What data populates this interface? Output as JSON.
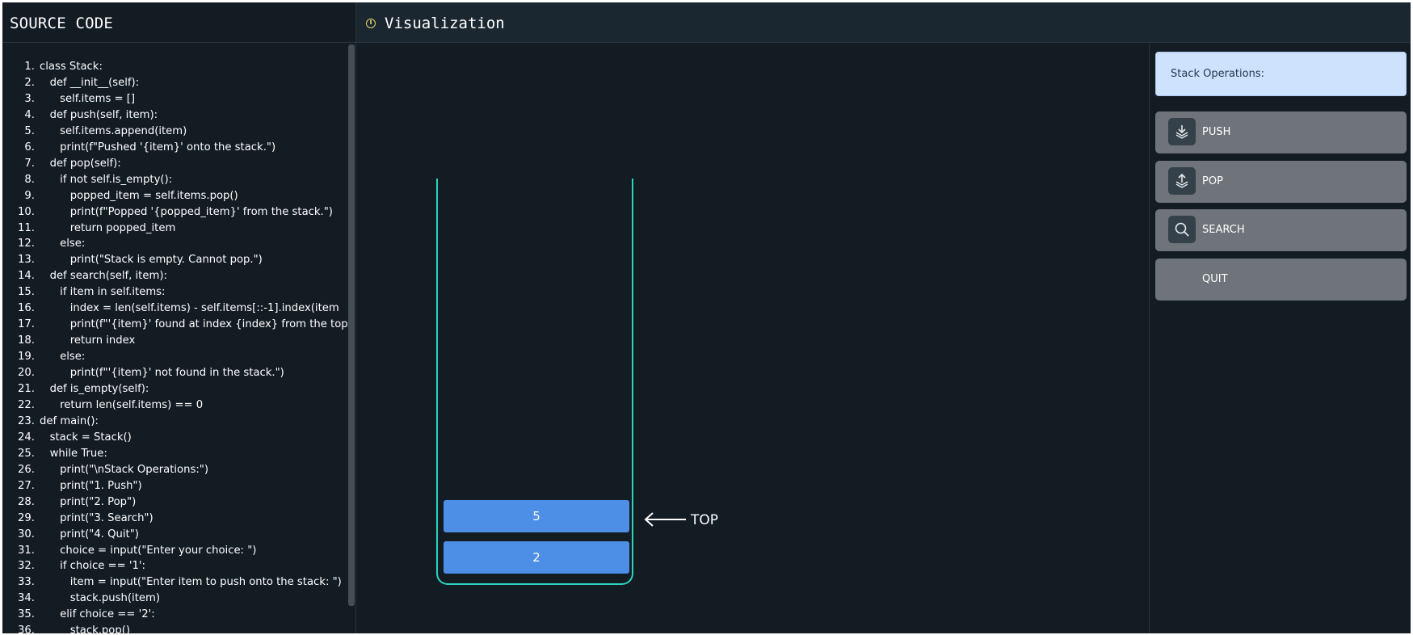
{
  "source_panel": {
    "title": "SOURCE CODE",
    "lines": [
      {
        "n": "1.",
        "text": "class Stack:"
      },
      {
        "n": "2.",
        "text": "   def __init__(self):"
      },
      {
        "n": "3.",
        "text": "      self.items = []"
      },
      {
        "n": "4.",
        "text": "   def push(self, item):"
      },
      {
        "n": "5.",
        "text": "      self.items.append(item)"
      },
      {
        "n": "6.",
        "text": "      print(f\"Pushed '{item}' onto the stack.\")"
      },
      {
        "n": "7.",
        "text": "   def pop(self):"
      },
      {
        "n": "8.",
        "text": "      if not self.is_empty():"
      },
      {
        "n": "9.",
        "text": "         popped_item = self.items.pop()"
      },
      {
        "n": "10.",
        "text": "         print(f\"Popped '{popped_item}' from the stack.\")"
      },
      {
        "n": "11.",
        "text": "         return popped_item"
      },
      {
        "n": "12.",
        "text": "      else:"
      },
      {
        "n": "13.",
        "text": "         print(\"Stack is empty. Cannot pop.\")"
      },
      {
        "n": "14.",
        "text": "   def search(self, item):"
      },
      {
        "n": "15.",
        "text": "      if item in self.items:"
      },
      {
        "n": "16.",
        "text": "         index = len(self.items) - self.items[::-1].index(item"
      },
      {
        "n": "17.",
        "text": "         print(f\"'{item}' found at index {index} from the top"
      },
      {
        "n": "18.",
        "text": "         return index"
      },
      {
        "n": "19.",
        "text": "      else:"
      },
      {
        "n": "20.",
        "text": "         print(f\"'{item}' not found in the stack.\")"
      },
      {
        "n": "21.",
        "text": "   def is_empty(self):"
      },
      {
        "n": "22.",
        "text": "      return len(self.items) == 0"
      },
      {
        "n": "23.",
        "text": "def main():"
      },
      {
        "n": "24.",
        "text": "   stack = Stack()"
      },
      {
        "n": "25.",
        "text": "   while True:"
      },
      {
        "n": "26.",
        "text": "      print(\"\\nStack Operations:\")"
      },
      {
        "n": "27.",
        "text": "      print(\"1. Push\")"
      },
      {
        "n": "28.",
        "text": "      print(\"2. Pop\")"
      },
      {
        "n": "29.",
        "text": "      print(\"3. Search\")"
      },
      {
        "n": "30.",
        "text": "      print(\"4. Quit\")"
      },
      {
        "n": "31.",
        "text": "      choice = input(\"Enter your choice: \")"
      },
      {
        "n": "32.",
        "text": "      if choice == '1':"
      },
      {
        "n": "33.",
        "text": "         item = input(\"Enter item to push onto the stack: \")"
      },
      {
        "n": "34.",
        "text": "         stack.push(item)"
      },
      {
        "n": "35.",
        "text": "      elif choice == '2':"
      },
      {
        "n": "36.",
        "text": "         stack.pop()"
      }
    ]
  },
  "visualization": {
    "title": "Visualization",
    "stack_items": [
      "5",
      "2"
    ],
    "top_label": "TOP"
  },
  "operations": {
    "header": "Stack Operations:",
    "buttons": [
      {
        "label": "PUSH",
        "icon": "push-icon"
      },
      {
        "label": "POP",
        "icon": "pop-icon"
      },
      {
        "label": "SEARCH",
        "icon": "search-icon"
      },
      {
        "label": "QUIT",
        "icon": ""
      }
    ]
  },
  "colors": {
    "background": "#131b23",
    "stack_outline": "#2dd4bf",
    "stack_item": "#4d8fe6",
    "button": "#6e7479",
    "ops_header": "#cfe2fd"
  }
}
